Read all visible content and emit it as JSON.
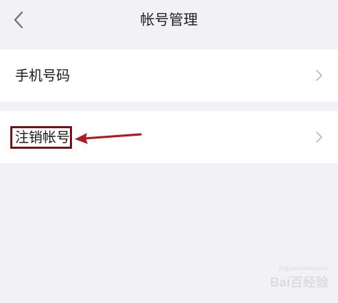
{
  "header": {
    "title": "帐号管理"
  },
  "settings": {
    "items": [
      {
        "label": "手机号码",
        "icon": "chevron-right-icon"
      },
      {
        "label": "注销帐号",
        "icon": "chevron-right-icon"
      }
    ]
  },
  "annotation": {
    "color": "#b0191e",
    "box_color": "#7a0d12"
  },
  "watermark": {
    "main": "Bai百经验",
    "sub": "jingyan.baidu.com"
  }
}
